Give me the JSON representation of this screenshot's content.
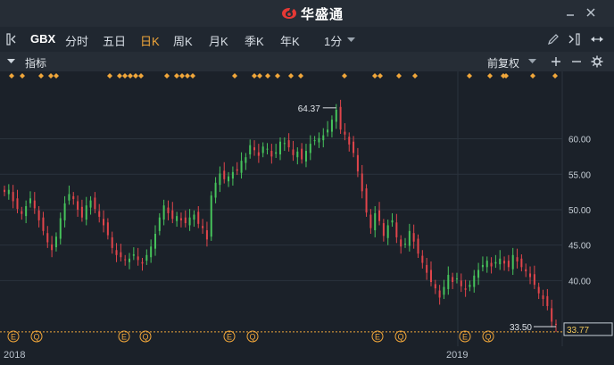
{
  "app": {
    "brand": "华盛通"
  },
  "toolbar": {
    "symbol": "GBX",
    "periods": [
      "分时",
      "五日",
      "日K",
      "周K",
      "月K",
      "季K",
      "年K"
    ],
    "active_period": "日K",
    "minute": "1分"
  },
  "subbar": {
    "indicator_label": "指标",
    "adjust_label": "前复权"
  },
  "chart_data": {
    "type": "candlestick",
    "ylim": [
      33.0,
      68.0
    ],
    "y_ticks": [
      "60.00",
      "55.00",
      "50.00",
      "45.00",
      "40.00"
    ],
    "x_labels": [
      "2018",
      "2019"
    ],
    "high_label": "64.37",
    "low_label": "33.50",
    "last_price": "33.77",
    "event_markers": [
      "E",
      "Q",
      "E",
      "Q",
      "E",
      "Q",
      "E",
      "Q",
      "E",
      "Q"
    ],
    "closes": [
      52.5,
      52.8,
      51.2,
      50.1,
      49.4,
      50.5,
      51.6,
      50.2,
      48.5,
      47.0,
      45.4,
      44.3,
      46.2,
      48.8,
      50.9,
      52.2,
      51.5,
      50.0,
      48.9,
      50.6,
      51.3,
      50.1,
      49.0,
      47.8,
      46.4,
      44.6,
      43.6,
      43.3,
      42.9,
      43.1,
      43.7,
      42.9,
      42.4,
      43.6,
      44.8,
      46.6,
      48.9,
      50.6,
      49.5,
      48.7,
      49.1,
      48.5,
      48.1,
      48.9,
      49.3,
      48.0,
      47.4,
      45.8,
      52.0,
      53.8,
      55.1,
      54.3,
      54.7,
      55.3,
      55.5,
      56.9,
      57.4,
      59.1,
      58.4,
      57.6,
      58.9,
      58.6,
      57.5,
      58.1,
      59.6,
      59.4,
      58.8,
      57.7,
      58.2,
      57.1,
      58.3,
      59.3,
      59.8,
      60.1,
      60.5,
      61.3,
      62.7,
      64.1,
      61.3,
      60.6,
      59.2,
      58.0,
      55.4,
      52.6,
      49.6,
      47.4,
      49.5,
      48.4,
      46.3,
      47.8,
      48.5,
      46.1,
      44.8,
      45.2,
      47.0,
      45.5,
      43.8,
      42.5,
      41.1,
      39.8,
      38.9,
      37.6,
      39.1,
      40.8,
      39.8,
      40.3,
      39.2,
      38.7,
      39.4,
      40.7,
      41.5,
      42.2,
      42.8,
      42.0,
      42.6,
      43.1,
      42.4,
      41.9,
      43.6,
      42.7,
      41.9,
      41.3,
      40.5,
      39.4,
      38.2,
      37.4,
      36.4,
      34.2,
      33.77
    ],
    "markers_top": [
      13,
      25,
      46,
      57,
      63,
      123,
      134,
      140,
      146,
      152,
      158,
      187,
      198,
      204,
      210,
      216,
      263,
      285,
      291,
      300,
      311,
      326,
      337,
      386,
      420,
      426,
      447,
      465,
      526,
      549,
      564,
      567,
      597,
      622
    ]
  }
}
